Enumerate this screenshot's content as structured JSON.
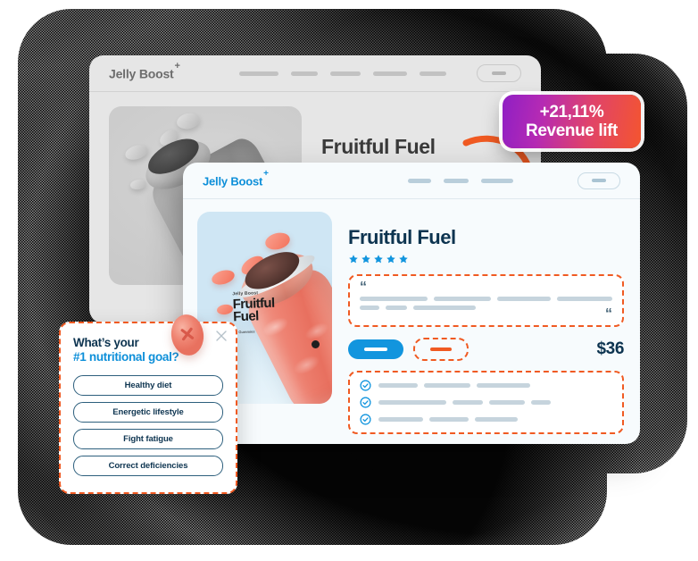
{
  "back_window": {
    "brand": "Jelly Boost",
    "brand_sup": "+",
    "nav_dash_widths": [
      44,
      30,
      34,
      38,
      30
    ],
    "product": {
      "title": "Fruitful Fuel",
      "stars": "★★★★★",
      "star_count": 5
    }
  },
  "badge": {
    "line1": "+21,11%",
    "line2": "Revenue lift",
    "gradient_from": "#8f1fc4",
    "gradient_to": "#f4552f"
  },
  "arrow": {
    "name": "curved-arrow",
    "color": "#f05a22"
  },
  "front_window": {
    "brand": "Jelly Boost",
    "brand_sup": "+",
    "nav_dash_widths": [
      26,
      28,
      36
    ],
    "hero": {
      "jar_label_brand": "Jelly Boost",
      "jar_label_name": "Fruitful Fuel",
      "jar_label_sub": "90 Gummies"
    },
    "product": {
      "title": "Fruitful Fuel",
      "star_count": 5,
      "star_color": "#1295de",
      "price": "$36"
    },
    "review_box": {
      "quote_open": "“",
      "quote_close": "“",
      "line1_widths": [
        76,
        64,
        60,
        62
      ],
      "line2_widths": [
        22,
        24,
        70
      ]
    },
    "buttons": {
      "primary_name": "add-to-cart-button",
      "secondary_name": "subscribe-button"
    },
    "benefits": [
      {
        "check": true,
        "line_widths": [
          44,
          52,
          60
        ]
      },
      {
        "check": true,
        "line_widths": [
          76,
          34,
          40,
          22
        ]
      },
      {
        "check": true,
        "line_widths": [
          50,
          44,
          48
        ]
      }
    ]
  },
  "quiz_popup": {
    "title_line1": "What’s your",
    "title_line2": "#1 nutritional goal?",
    "close_label": "×",
    "options": [
      "Healthy diet",
      "Energetic lifestyle",
      "Fight fatigue",
      "Correct deficiencies"
    ],
    "accent_color": "#f05a22",
    "title_color": "#0d3450",
    "highlight_color": "#0d8fd9"
  }
}
